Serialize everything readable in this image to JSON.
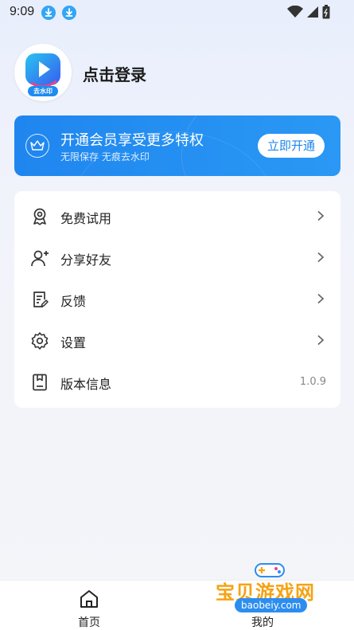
{
  "status_bar": {
    "time": "9:09"
  },
  "profile": {
    "avatar_tag": "去水印",
    "login_text": "点击登录"
  },
  "vip": {
    "title": "开通会员享受更多特权",
    "subtitle": "无限保存 无痕去水印",
    "button_label": "立即开通"
  },
  "menu": {
    "items": [
      {
        "label": "免费试用",
        "icon": "badge-icon"
      },
      {
        "label": "分享好友",
        "icon": "add-user-icon"
      },
      {
        "label": "反馈",
        "icon": "feedback-icon"
      },
      {
        "label": "设置",
        "icon": "gear-icon"
      },
      {
        "label": "版本信息",
        "icon": "book-icon",
        "value": "1.0.9"
      }
    ]
  },
  "bottom_nav": {
    "home_label": "首页",
    "mine_label": "我的"
  },
  "watermark": {
    "text": "宝贝游戏网",
    "url": "baobeiy.com"
  },
  "colors": {
    "accent": "#1f86ef",
    "watermark": "#f5a315"
  }
}
